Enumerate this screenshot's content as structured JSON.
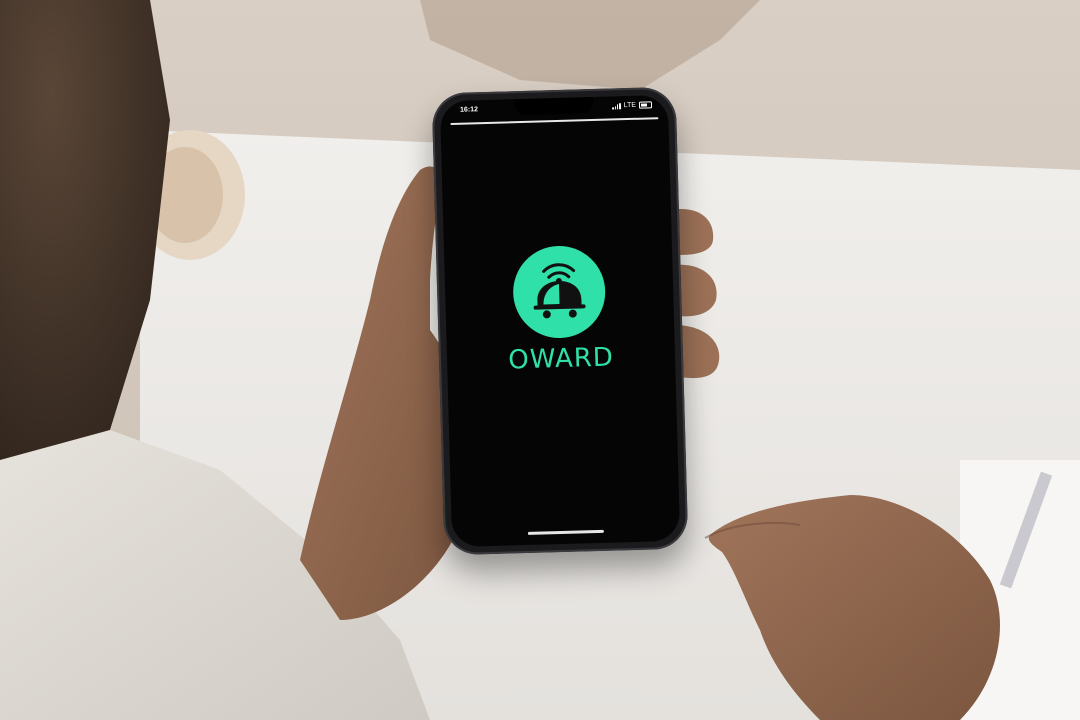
{
  "status_bar": {
    "time": "16:12",
    "network": "LTE"
  },
  "app": {
    "brand_name": "OWARD",
    "logo_icon": "robot-bell-icon",
    "accent_color": "#2fe0a8",
    "screen_background": "#050505"
  }
}
